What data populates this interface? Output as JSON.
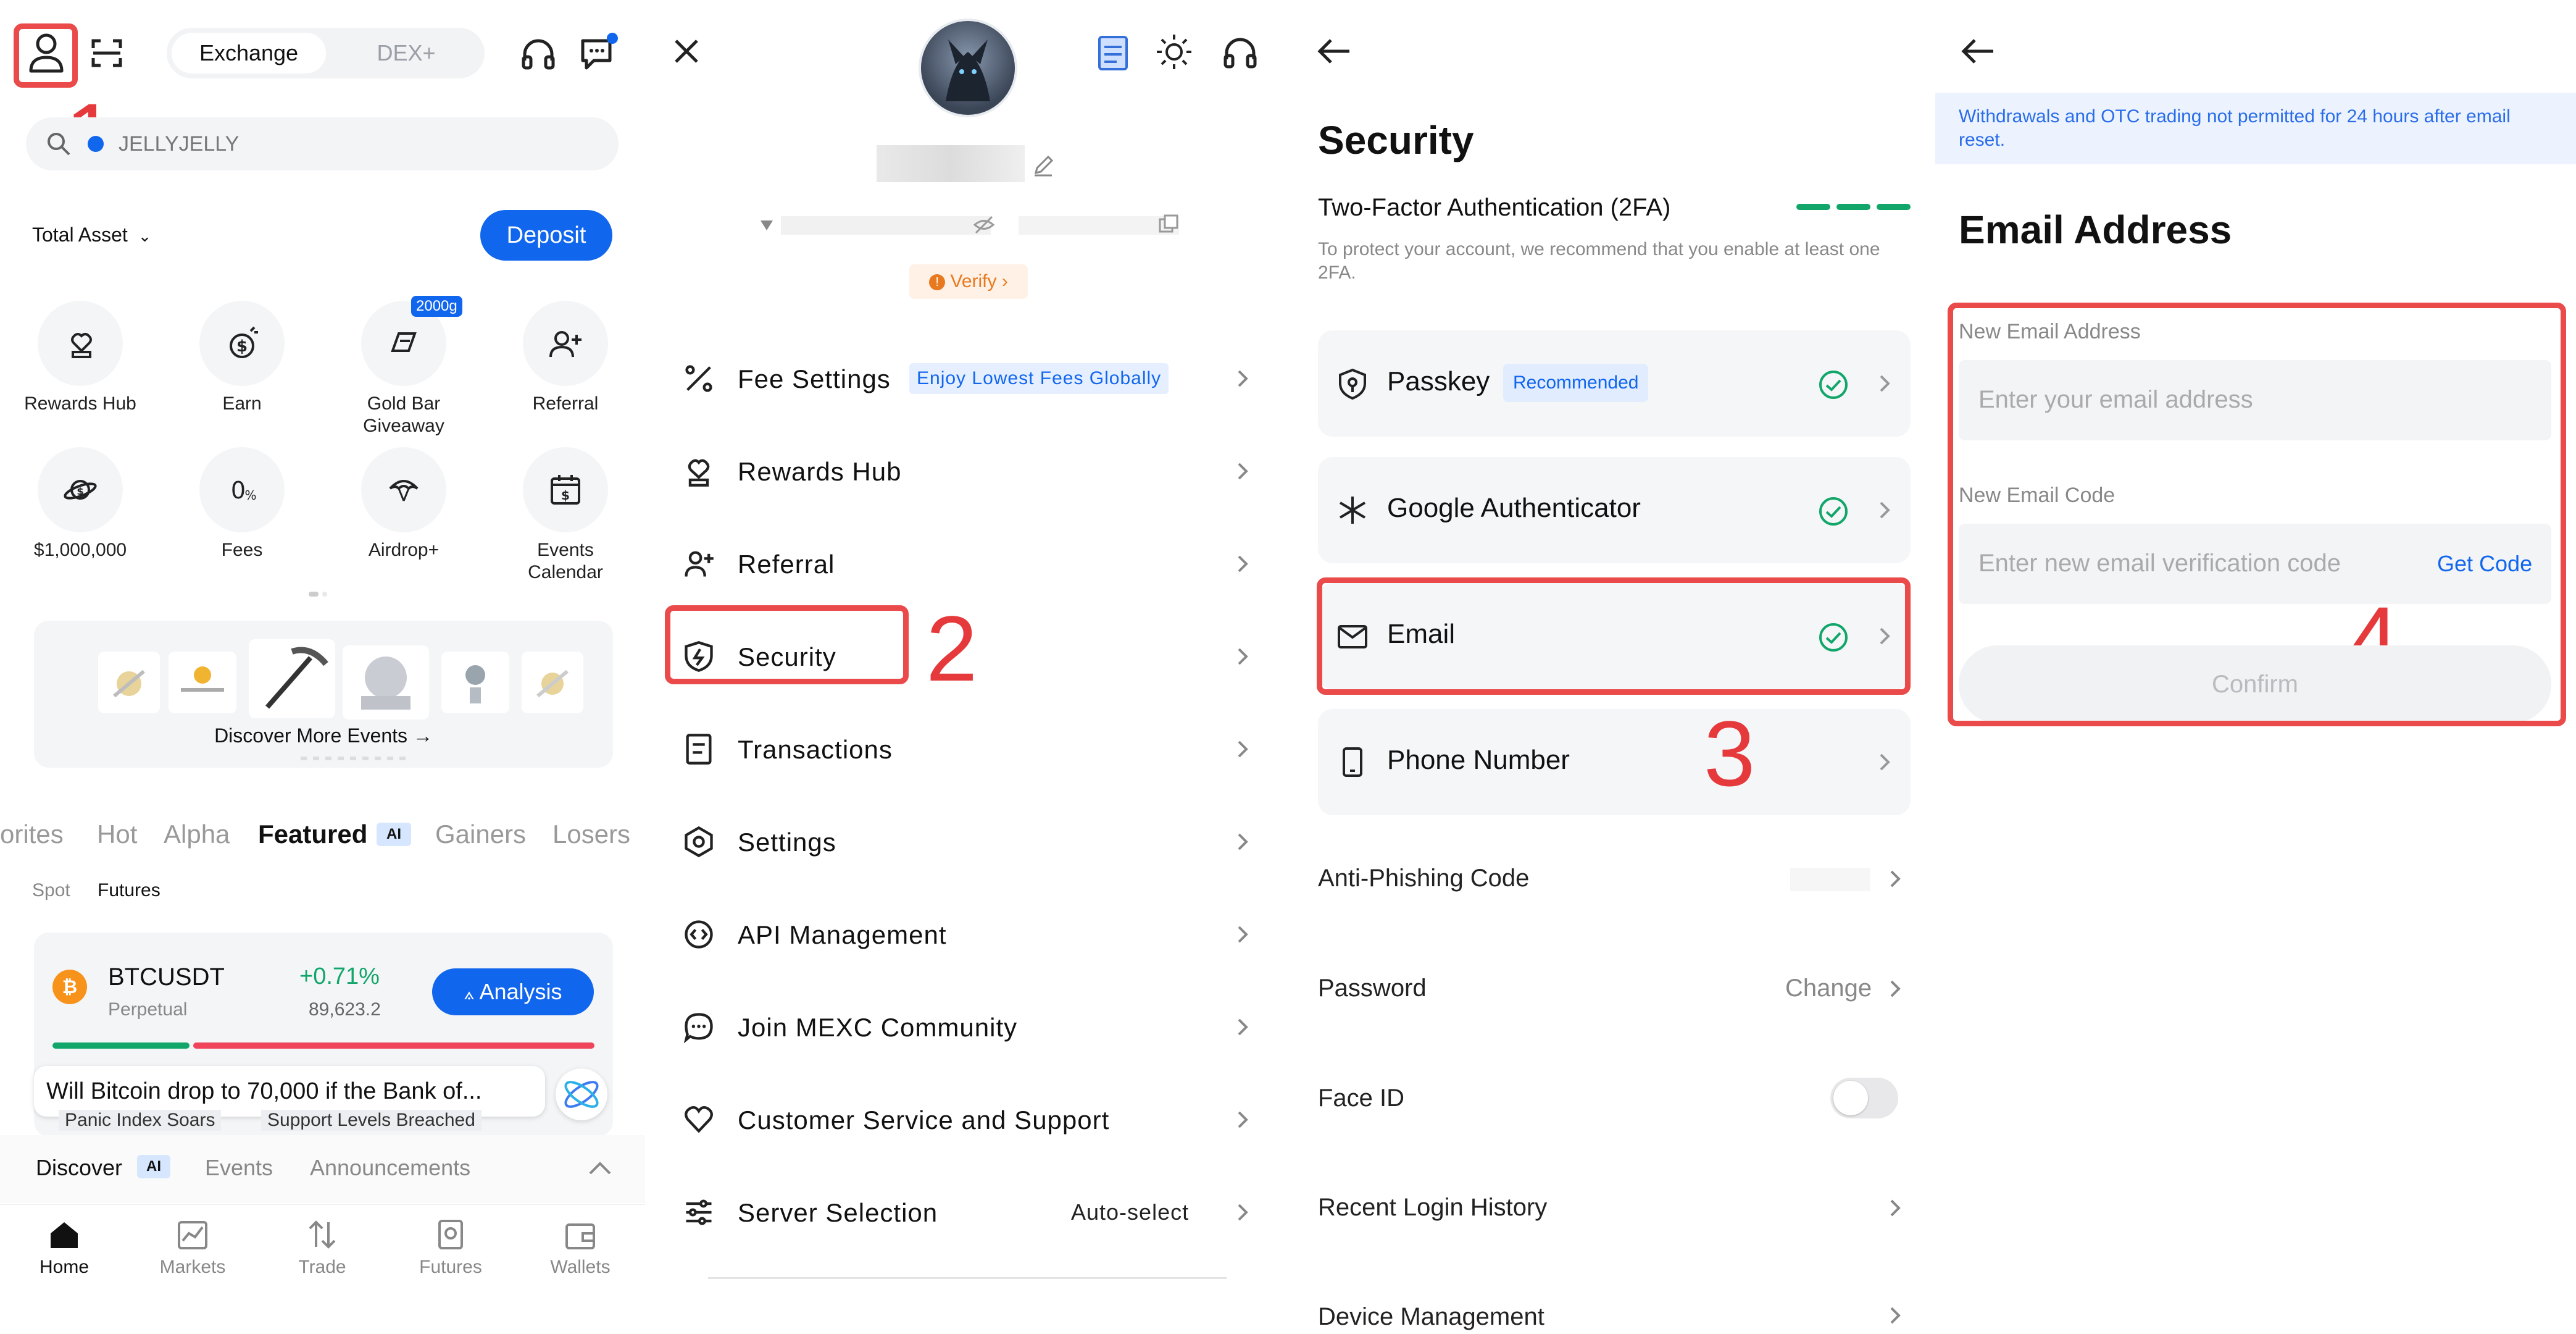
{
  "steps": [
    "1",
    "2",
    "3",
    "4"
  ],
  "home": {
    "tabs": {
      "exchange": "Exchange",
      "dex": "DEX+"
    },
    "search_text": "JELLYJELLY",
    "total_asset_label": "Total Asset",
    "deposit_label": "Deposit",
    "features": [
      {
        "label": "Rewards Hub",
        "icon": "rewards-icon"
      },
      {
        "label": "Earn",
        "icon": "earn-icon"
      },
      {
        "label": "Gold Bar Giveaway",
        "icon": "gold-bar-icon",
        "badge": "2000g"
      },
      {
        "label": "Referral",
        "icon": "referral-icon"
      },
      {
        "label": "$1,000,000",
        "icon": "planet-icon"
      },
      {
        "label": "Fees",
        "icon": "zero-fee-icon"
      },
      {
        "label": "Airdrop+",
        "icon": "airdrop-icon"
      },
      {
        "label": "Events Calendar",
        "icon": "calendar-icon"
      }
    ],
    "discover_events": "Discover More Events →",
    "market_tabs": [
      "orites",
      "Hot",
      "Alpha",
      "Featured",
      "Gainers",
      "Losers"
    ],
    "active_market_tab": "Featured",
    "subtabs": [
      "Spot",
      "Futures"
    ],
    "ticker": {
      "symbol": "BTCUSDT",
      "type": "Perpetual",
      "change": "+0.71%",
      "price": "89,623.2",
      "analysis_label": "Analysis"
    },
    "news_bubble": "Will Bitcoin drop to 70,000 if the Bank of...",
    "news_tags": [
      "Panic Index Soars",
      "Support Levels Breached"
    ],
    "discover_tabs": [
      "Discover",
      "Events",
      "Announcements"
    ],
    "bottom_nav": [
      "Home",
      "Markets",
      "Trade",
      "Futures",
      "Wallets"
    ],
    "colors": {
      "accent": "#1166ee",
      "up": "#12a66b",
      "down": "#f0445a"
    }
  },
  "menu": {
    "verify_label": "Verify",
    "items": [
      {
        "label": "Fee Settings",
        "icon": "fee-icon",
        "tag": "Enjoy Lowest Fees Globally"
      },
      {
        "label": "Rewards Hub",
        "icon": "rewards-icon"
      },
      {
        "label": "Referral",
        "icon": "referral-icon"
      },
      {
        "label": "Security",
        "icon": "shield-icon"
      },
      {
        "label": "Transactions",
        "icon": "document-icon"
      },
      {
        "label": "Settings",
        "icon": "settings-icon"
      },
      {
        "label": "API Management",
        "icon": "api-icon"
      },
      {
        "label": "Join MEXC Community",
        "icon": "chat-icon"
      },
      {
        "label": "Customer Service and Support",
        "icon": "heart-icon"
      },
      {
        "label": "Server Selection",
        "icon": "sliders-icon",
        "value": "Auto-select"
      }
    ]
  },
  "security": {
    "title": "Security",
    "twofa_title": "Two-Factor Authentication (2FA)",
    "twofa_desc": "To protect your account, we recommend that you enable at least one 2FA.",
    "cards": [
      {
        "label": "Passkey",
        "tag": "Recommended",
        "enabled": true
      },
      {
        "label": "Google Authenticator",
        "enabled": true
      },
      {
        "label": "Email",
        "enabled": true
      },
      {
        "label": "Phone Number",
        "enabled": false
      }
    ],
    "rows": [
      {
        "label": "Anti-Phishing Code"
      },
      {
        "label": "Password",
        "value": "Change"
      },
      {
        "label": "Face ID",
        "toggle": false
      },
      {
        "label": "Recent Login History"
      },
      {
        "label": "Device Management"
      }
    ]
  },
  "email": {
    "notice": "Withdrawals and OTC trading not permitted for 24 hours after email reset.",
    "title": "Email Address",
    "new_email_label": "New Email Address",
    "new_email_placeholder": "Enter your email address",
    "code_label": "New Email Code",
    "code_placeholder": "Enter new email verification code",
    "get_code": "Get Code",
    "confirm": "Confirm"
  }
}
